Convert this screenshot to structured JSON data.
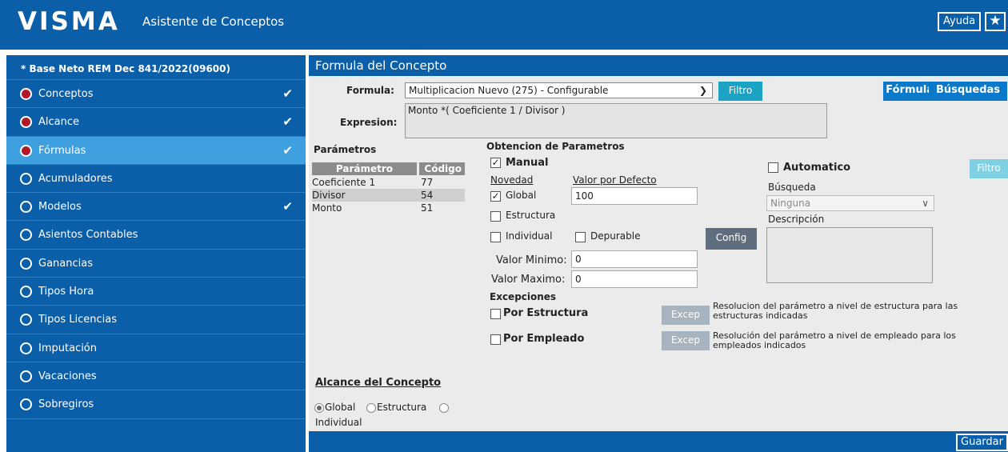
{
  "header": {
    "logo": "VISMA",
    "app_title": "Asistente de Conceptos",
    "help_label": "Ayuda",
    "star_icon": "★"
  },
  "sidebar": {
    "title": "* Base Neto REM Dec 841/2022(09600)",
    "items": [
      {
        "label": "Conceptos",
        "status": "done",
        "checked": true
      },
      {
        "label": "Alcance",
        "status": "done",
        "checked": true
      },
      {
        "label": "Fórmulas",
        "status": "active",
        "checked": true
      },
      {
        "label": "Acumuladores",
        "status": "pending",
        "checked": false
      },
      {
        "label": "Modelos",
        "status": "pending",
        "checked": true
      },
      {
        "label": "Asientos Contables",
        "status": "pending",
        "checked": false
      },
      {
        "label": "Ganancias",
        "status": "pending",
        "checked": false
      },
      {
        "label": "Tipos Hora",
        "status": "pending",
        "checked": false
      },
      {
        "label": "Tipos Licencias",
        "status": "pending",
        "checked": false
      },
      {
        "label": "Imputación",
        "status": "pending",
        "checked": false
      },
      {
        "label": "Vacaciones",
        "status": "pending",
        "checked": false
      },
      {
        "label": "Sobregiros",
        "status": "pending",
        "checked": false
      }
    ],
    "check_glyph": "✔"
  },
  "main": {
    "title": "Formula del Concepto",
    "formula_label": "Formula:",
    "formula_value": "Multiplicacion Nuevo (275) - Configurable",
    "filtro_label": "Filtro",
    "formulas_button": "Fórmulas",
    "busquedas_button": "Búsquedas",
    "expresion_label": "Expresion:",
    "expresion_value": "Monto *( Coeficiente 1 / Divisor )",
    "parametros": {
      "title": "Parámetros",
      "col_param": "Parámetro",
      "col_code": "Código",
      "rows": [
        {
          "param": "Coeficiente 1",
          "code": "77"
        },
        {
          "param": "Divisor",
          "code": "54"
        },
        {
          "param": "Monto",
          "code": "51"
        }
      ]
    },
    "obtencion": {
      "title": "Obtencion de Parametros",
      "manual_label": "Manual",
      "manual_checked": true,
      "novedad_label": "Novedad",
      "valor_defecto_label": "Valor por Defecto",
      "global_label": "Global",
      "global_checked": true,
      "valor_defecto_value": "100",
      "estructura_label": "Estructura",
      "individual_label": "Individual",
      "depurable_label": "Depurable",
      "config_label": "Config",
      "valor_minimo_label": "Valor Minimo:",
      "valor_minimo_value": "0",
      "valor_maximo_label": "Valor Maximo:",
      "valor_maximo_value": "0",
      "automatico_label": "Automatico",
      "filtro2_label": "Filtro",
      "busqueda_label": "Búsqueda",
      "busqueda_value": "Ninguna",
      "descripcion_label": "Descripción"
    },
    "excepciones": {
      "title": "Excepciones",
      "por_estructura": "Por Estructura",
      "por_empleado": "Por Empleado",
      "excep_label": "Excep",
      "estructura_desc": "Resolucion del parámetro a nivel de estructura para las estructuras indicadas",
      "empleado_desc": "Resolución del parámetro a nivel de empleado para los empleados indicados"
    },
    "alcance": {
      "title": "Alcance del Concepto",
      "global": "Global",
      "estructura": "Estructura",
      "individual": "Individual"
    },
    "guardar_label": "Guardar"
  },
  "colors": {
    "primary": "#0b5ea8",
    "active": "#3fa0e0",
    "done_dot": "#b3182a",
    "teal": "#1aa3c3"
  }
}
